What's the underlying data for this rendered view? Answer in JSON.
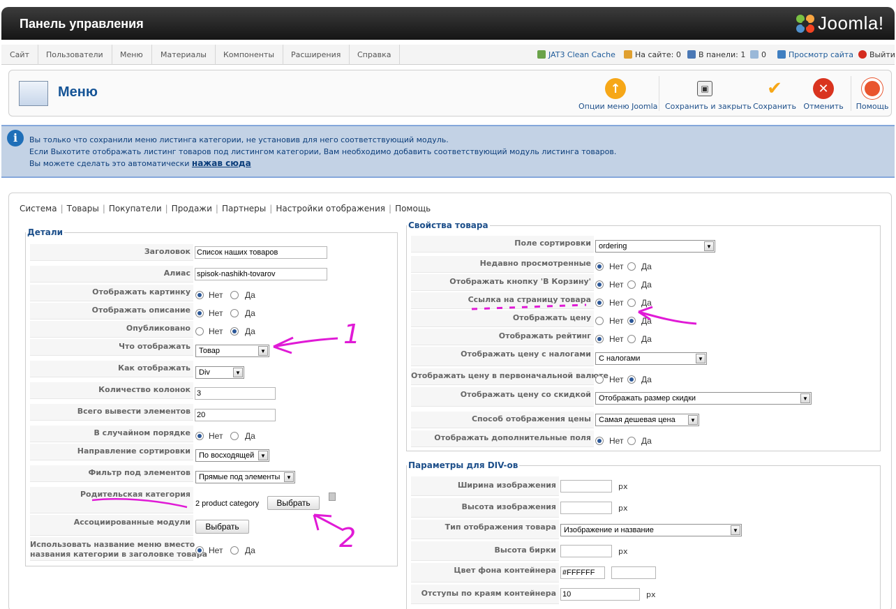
{
  "header": {
    "title": "Панель управления",
    "logo_text": "Joomla!"
  },
  "menu": {
    "items": [
      "Сайт",
      "Пользователи",
      "Меню",
      "Материалы",
      "Компоненты",
      "Расширения",
      "Справка"
    ],
    "status": {
      "cache": "JAT3 Clean Cache",
      "online": "На сайте: 0",
      "in_panel": "В панели: 1",
      "messages": "0",
      "view_site": "Просмотр сайта",
      "logout": "Выйти"
    }
  },
  "toolbar": {
    "title": "Меню",
    "buttons": {
      "options": "Опции меню Joomla",
      "save_close": "Сохранить и закрыть",
      "save": "Сохранить",
      "cancel": "Отменить",
      "help": "Помощь"
    },
    "icons": {
      "options": "up-arrow-icon",
      "save_close": "floppy-disk-icon",
      "save": "checkmark-icon",
      "cancel": "cancel-x-icon",
      "help": "lifebuoy-icon"
    }
  },
  "notice": {
    "line1": "Вы только что сохранили меню листинга категории, не установив для него соответствующий модуль.",
    "line2": "Если Выхотите отображать листинг товаров под листингом категории, Вам необходимо добавить соответствующий модуль листинга товаров.",
    "line3": "Вы можете сделать это автоматически",
    "link": "нажав сюда"
  },
  "tabs": [
    "Система",
    "Товары",
    "Покупатели",
    "Продажи",
    "Партнеры",
    "Настройки отображения",
    "Помощь"
  ],
  "radio": {
    "no": "Нет",
    "yes": "Да"
  },
  "details": {
    "legend": "Детали",
    "title_label": "Заголовок",
    "title_value": "Список наших товаров",
    "alias_label": "Алиас",
    "alias_value": "spisok-nashikh-tovarov",
    "show_image_label": "Отображать картинку",
    "show_desc_label": "Отображать описание",
    "published_label": "Опубликовано",
    "what_show_label": "Что отображать",
    "what_show_value": "Товар",
    "how_show_label": "Как отображать",
    "how_show_value": "Div",
    "columns_label": "Количество колонок",
    "columns_value": "3",
    "total_label": "Всего вывести элементов",
    "total_value": "20",
    "random_label": "В случайном порядке",
    "sort_dir_label": "Направление сортировки",
    "sort_dir_value": "По восходящей",
    "filter_label": "Фильтр под элементов",
    "filter_value": "Прямые под элементы",
    "parent_cat_label": "Родительская категория",
    "parent_cat_value": "2 product category",
    "choose_label": "Выбрать",
    "assoc_label": "Ассоциированные модули",
    "use_menu_name_label_1": "Использовать название меню вместо",
    "use_menu_name_label_2": "названия категории в заголовке товара"
  },
  "product_props": {
    "legend": "Свойства товара",
    "sort_field_label": "Поле сортировки",
    "sort_field_value": "ordering",
    "recently_viewed_label": "Недавно просмотренные",
    "cart_button_label": "Отображать кнопку 'В Корзину'",
    "product_link_label": "Ссылка на страницу товара",
    "show_price_label": "Отображать цену",
    "show_rating_label": "Отображать рейтинг",
    "price_tax_label": "Отображать цену с налогами",
    "price_tax_value": "С налогами",
    "orig_currency_label": "Отображать цену в первоначальной валюте",
    "discount_label": "Отображать цену со скидкой",
    "discount_value": "Отображать размер скидки",
    "price_mode_label": "Способ отображения цены",
    "price_mode_value": "Самая дешевая цена",
    "extra_fields_label": "Отображать дополнительные поля"
  },
  "div_params": {
    "legend": "Параметры для DIV-ов",
    "img_width_label": "Ширина изображения",
    "img_height_label": "Высота изображения",
    "display_type_label": "Тип отображения товара",
    "display_type_value": "Изображение и название",
    "label_height_label": "Высота бирки",
    "bg_color_label": "Цвет фона контейнера",
    "bg_color_value": "#FFFFFF",
    "padding_label": "Отступы по краям контейнера",
    "padding_value": "10",
    "px": "px"
  },
  "annotations": {
    "one": "1",
    "two": "2"
  }
}
